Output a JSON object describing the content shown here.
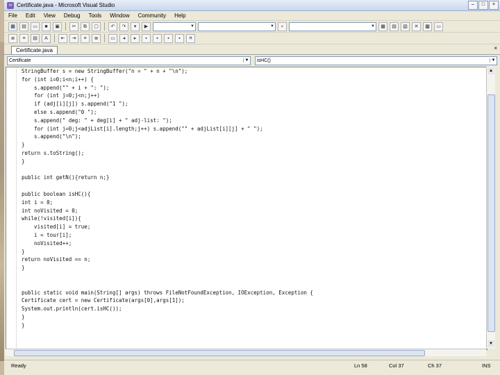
{
  "window": {
    "title": "Certificate.java - Microsoft Visual Studio"
  },
  "menu": [
    "File",
    "Edit",
    "View",
    "Debug",
    "Tools",
    "Window",
    "Community",
    "Help"
  ],
  "tab": {
    "label": "Certificate.java"
  },
  "nav": {
    "class_value": "Certificate",
    "member_value": "isHC()"
  },
  "code_lines": [
    "StringBuffer s = new StringBuffer(\"n = \" + n + \"\\n\");",
    "for (int i=0;i<n;i++) {",
    "    s.append(\"\" + i + \": \");",
    "    for (int j=0;j<n;j++)",
    "    if (adj[i][j]) s.append(\"1 \");",
    "    else s.append(\"0 \");",
    "    s.append(\" deg: \" + deg[i] + \" adj-list: \");",
    "    for (int j=0;j<adjList[i].length;j++) s.append(\"\" + adjList[i][j] + \" \");",
    "    s.append(\"\\n\");",
    "}",
    "return s.toString();",
    "}",
    "",
    "public int getN(){return n;}",
    "",
    "public boolean isHC(){",
    "int i = 0;",
    "int noVisited = 0;",
    "while(!visited[i]){",
    "    visited[i] = true;",
    "    i = tour[i];",
    "    noVisited++;",
    "}",
    "return noVisited == n;",
    "}",
    "",
    "",
    "public static void main(String[] args) throws FileNotFoundException, IOException, Exception {",
    "Certificate cert = new Certificate(args[0],args[1]);",
    "System.out.println(cert.isHC());",
    "}",
    "}"
  ],
  "status": {
    "ready": "Ready",
    "ln": "Ln 58",
    "col": "Col 37",
    "ch": "Ch 37",
    "ins": "INS"
  },
  "colors": {
    "title_bar": "#c9d6ec",
    "editor_bg": "#ffffff",
    "chrome": "#ece9d8"
  }
}
